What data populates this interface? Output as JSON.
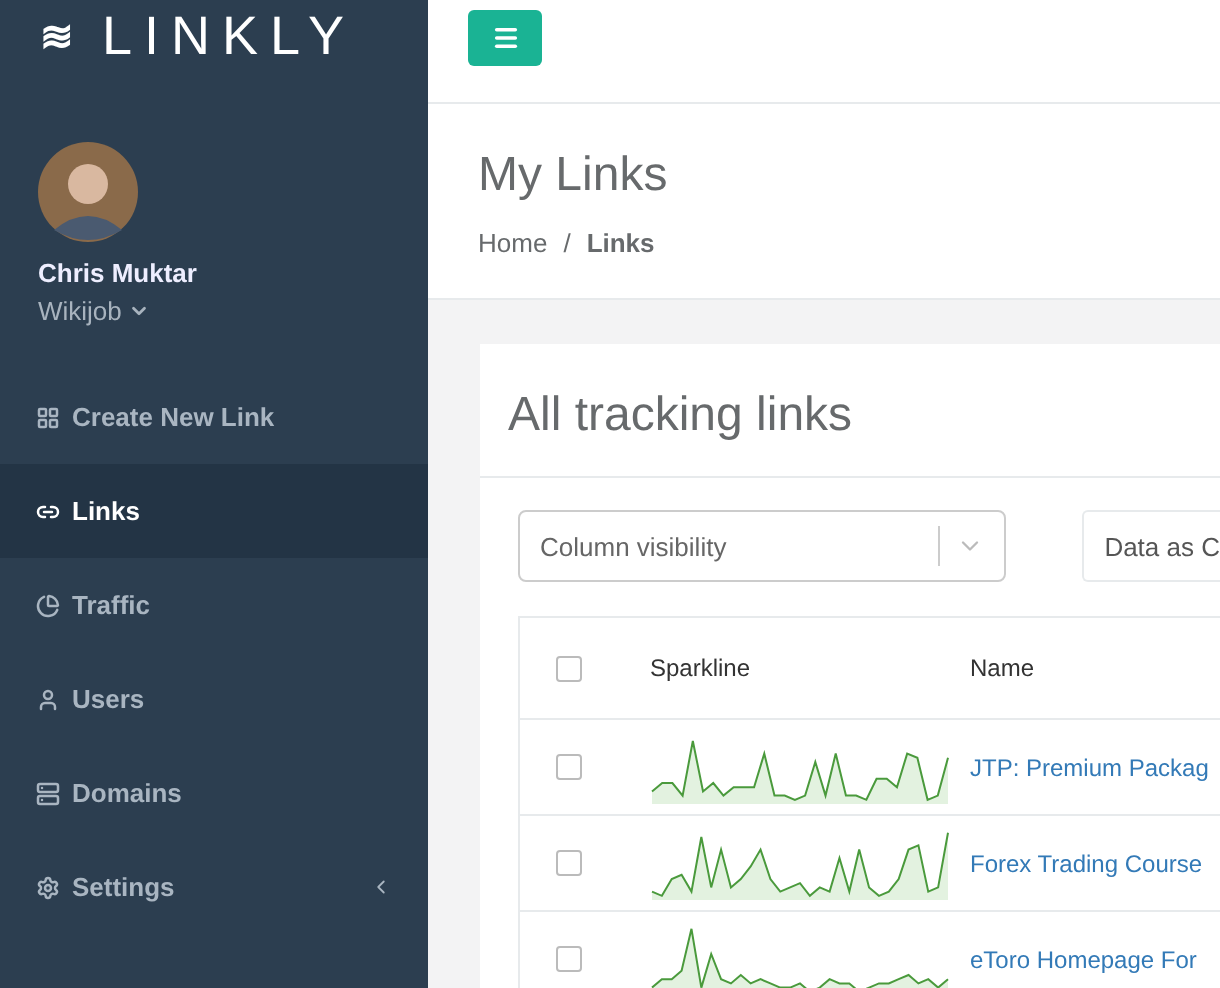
{
  "sidebar": {
    "logo_glyph": "≋",
    "brand": "LINKLY",
    "user": {
      "name": "Chris Muktar",
      "org": "Wikijob"
    },
    "items": [
      {
        "label": "Create New Link",
        "selected": false
      },
      {
        "label": "Links",
        "selected": true
      },
      {
        "label": "Traffic",
        "selected": false
      },
      {
        "label": "Users",
        "selected": false
      },
      {
        "label": "Domains",
        "selected": false
      },
      {
        "label": "Settings",
        "selected": false,
        "expandable": true
      }
    ]
  },
  "header": {
    "title": "My Links",
    "separator": "/",
    "breadcrumb": [
      {
        "label": "Home",
        "current": false
      },
      {
        "label": "Links",
        "current": true
      }
    ]
  },
  "card": {
    "title": "All tracking links",
    "column_visibility": {
      "placeholder": "Column visibility"
    },
    "export_button": "Data as C",
    "table": {
      "all_checked": false,
      "columns": [
        "Sparkline",
        "Name"
      ],
      "rows": [
        {
          "checked": false,
          "name": "JTP: Premium Packag"
        },
        {
          "checked": false,
          "name": "Forex Trading Course"
        },
        {
          "checked": false,
          "name": "eToro Homepage For"
        }
      ]
    }
  }
}
